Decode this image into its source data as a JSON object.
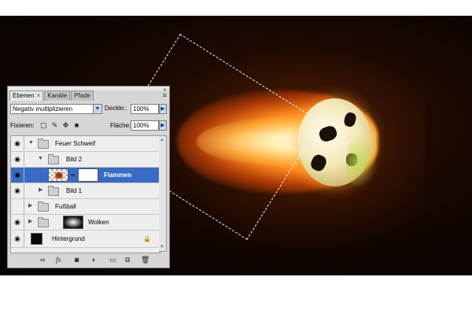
{
  "panel": {
    "tabs": [
      {
        "label": "Ebenen",
        "active": true
      },
      {
        "label": "Kanäle",
        "active": false
      },
      {
        "label": "Pfade",
        "active": false
      }
    ],
    "tab_close_glyph": "×",
    "close_glyph": "×",
    "menu_glyph": "≡",
    "blend_mode": "Negativ multiplizieren",
    "opacity_label": "Deckkr.:",
    "opacity_value": "100%",
    "lock_label": "Fixieren:",
    "fill_label": "Fläche:",
    "fill_value": "100%"
  },
  "layers": [
    {
      "name": "Feuer Schweif",
      "type": "group",
      "expanded": true,
      "visible": true,
      "indent": 0
    },
    {
      "name": "Bild 2",
      "type": "group",
      "expanded": true,
      "visible": true,
      "indent": 1
    },
    {
      "name": "Flammen",
      "type": "layer",
      "visible": true,
      "selected": true,
      "indent": 2,
      "mask": true
    },
    {
      "name": "Bild 1",
      "type": "group",
      "expanded": false,
      "visible": true,
      "indent": 1
    },
    {
      "name": "Fußball",
      "type": "group",
      "expanded": false,
      "visible": false,
      "indent": 0
    },
    {
      "name": "Wolken",
      "type": "group",
      "expanded": false,
      "visible": true,
      "indent": 0,
      "thumbnail": "cloud"
    },
    {
      "name": "Hintergrund",
      "type": "background",
      "visible": true,
      "locked": true,
      "indent": 0
    }
  ],
  "icons": {
    "eye": "eye-icon",
    "lock": "lock-icon",
    "link": "link-icon",
    "fx": "fx-icon",
    "mask": "add-mask-icon",
    "adjust": "adjustment-layer-icon",
    "new_group": "new-group-icon",
    "new_layer": "new-layer-icon",
    "trash": "trash-icon"
  },
  "bottom_bar": {
    "fx_label": "fx"
  }
}
